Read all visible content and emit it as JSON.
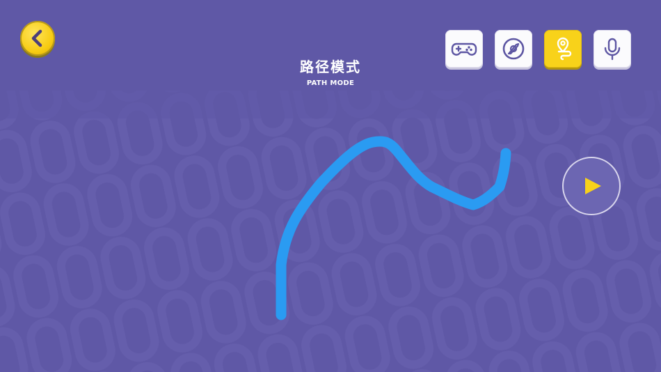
{
  "header": {
    "title": "路径模式",
    "subtitle": "PATH MODE"
  },
  "toolbar": {
    "back_icon": "chevron-left-icon",
    "modes": [
      {
        "icon": "gamepad-icon",
        "active": false
      },
      {
        "icon": "gravity-compass-icon",
        "active": false
      },
      {
        "icon": "path-pin-icon",
        "active": true
      },
      {
        "icon": "microphone-icon",
        "active": false
      }
    ],
    "play_icon": "play-icon"
  },
  "colors": {
    "background": "#5f58a6",
    "path_stroke": "#2a9bf2",
    "active_mode": "#f8d21a",
    "play_triangle": "#f8d21a",
    "back_button": "#f7cc13",
    "icon_stroke": "#5d56a3"
  }
}
